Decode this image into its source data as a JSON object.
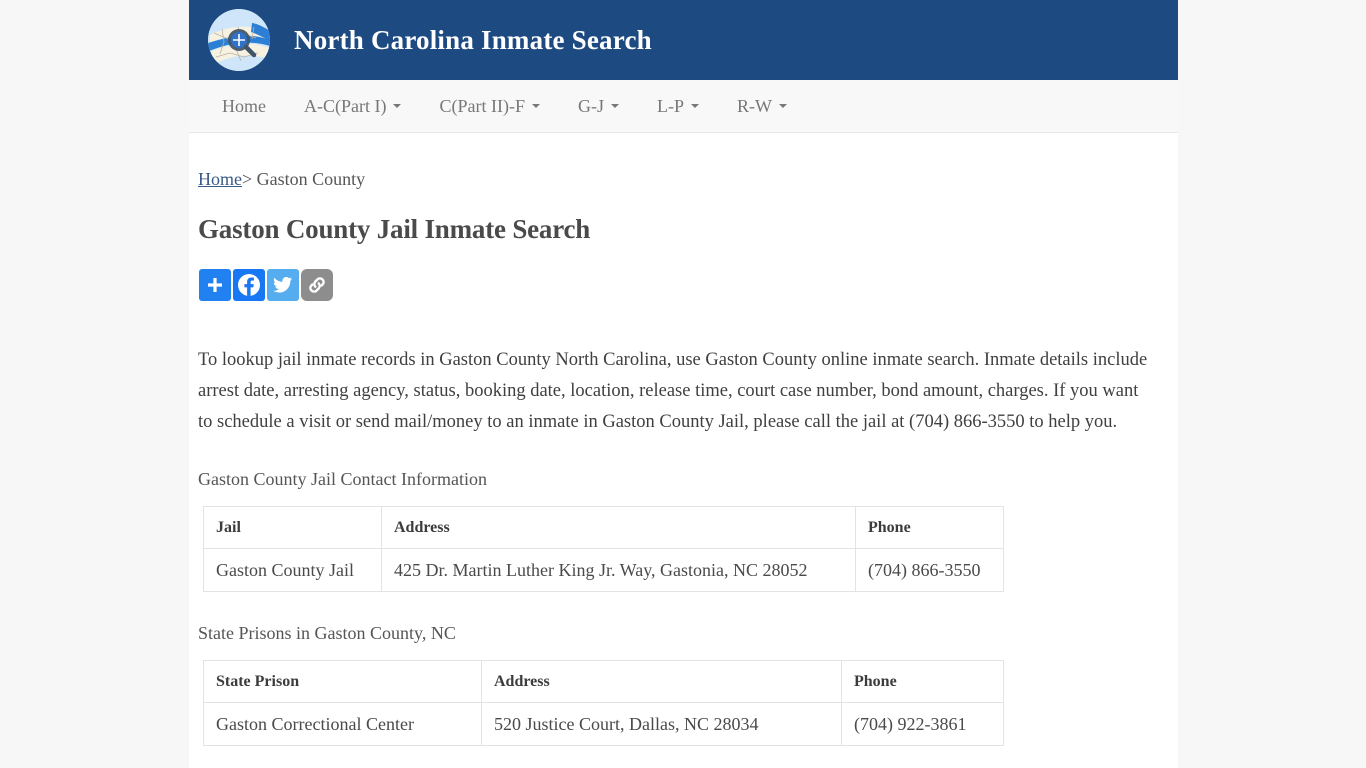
{
  "header": {
    "title": "North Carolina Inmate Search",
    "logo_icon": "nc-map-magnifier-icon",
    "background_color": "#1d4a80"
  },
  "nav": {
    "items": [
      {
        "label": "Home",
        "has_dropdown": false
      },
      {
        "label": "A-C(Part I)",
        "has_dropdown": true
      },
      {
        "label": "C(Part II)-F",
        "has_dropdown": true
      },
      {
        "label": "G-J",
        "has_dropdown": true
      },
      {
        "label": "L-P",
        "has_dropdown": true
      },
      {
        "label": "R-W",
        "has_dropdown": true
      }
    ]
  },
  "breadcrumb": {
    "home_label": "Home",
    "separator": ">",
    "current_label": "Gaston County"
  },
  "page": {
    "title": "Gaston County Jail Inmate Search",
    "intro": "To lookup jail inmate records in Gaston County North Carolina, use Gaston County online inmate search. Inmate details include arrest date, arresting agency, status, booking date, location, release time, court case number, bond amount, charges. If you want to schedule a visit or send mail/money to an inmate in Gaston County Jail, please call the jail at (704) 866-3550 to help you.",
    "jail_section_label": "Gaston County Jail Contact Information",
    "prison_section_label": "State Prisons in Gaston County, NC"
  },
  "share": {
    "buttons": [
      {
        "name": "addthis-plus",
        "icon": "plus-icon",
        "label": "Share",
        "color": "#2281f0"
      },
      {
        "name": "facebook",
        "icon": "facebook-icon",
        "label": "Facebook",
        "color": "#1877f2"
      },
      {
        "name": "twitter",
        "icon": "twitter-icon",
        "label": "Twitter",
        "color": "#55acee"
      },
      {
        "name": "copy-link",
        "icon": "link-icon",
        "label": "Copy Link",
        "color": "#8d8d8d"
      }
    ]
  },
  "jail_table": {
    "headers": [
      "Jail",
      "Address",
      "Phone"
    ],
    "rows": [
      {
        "name": "Gaston County Jail",
        "address": "425 Dr. Martin Luther King Jr. Way, Gastonia, NC 28052",
        "phone": "(704) 866-3550"
      }
    ]
  },
  "prison_table": {
    "headers": [
      "State Prison",
      "Address",
      "Phone"
    ],
    "rows": [
      {
        "name": "Gaston Correctional Center",
        "address": "520 Justice Court, Dallas, NC 28034",
        "phone": "(704) 922-3861"
      }
    ]
  }
}
